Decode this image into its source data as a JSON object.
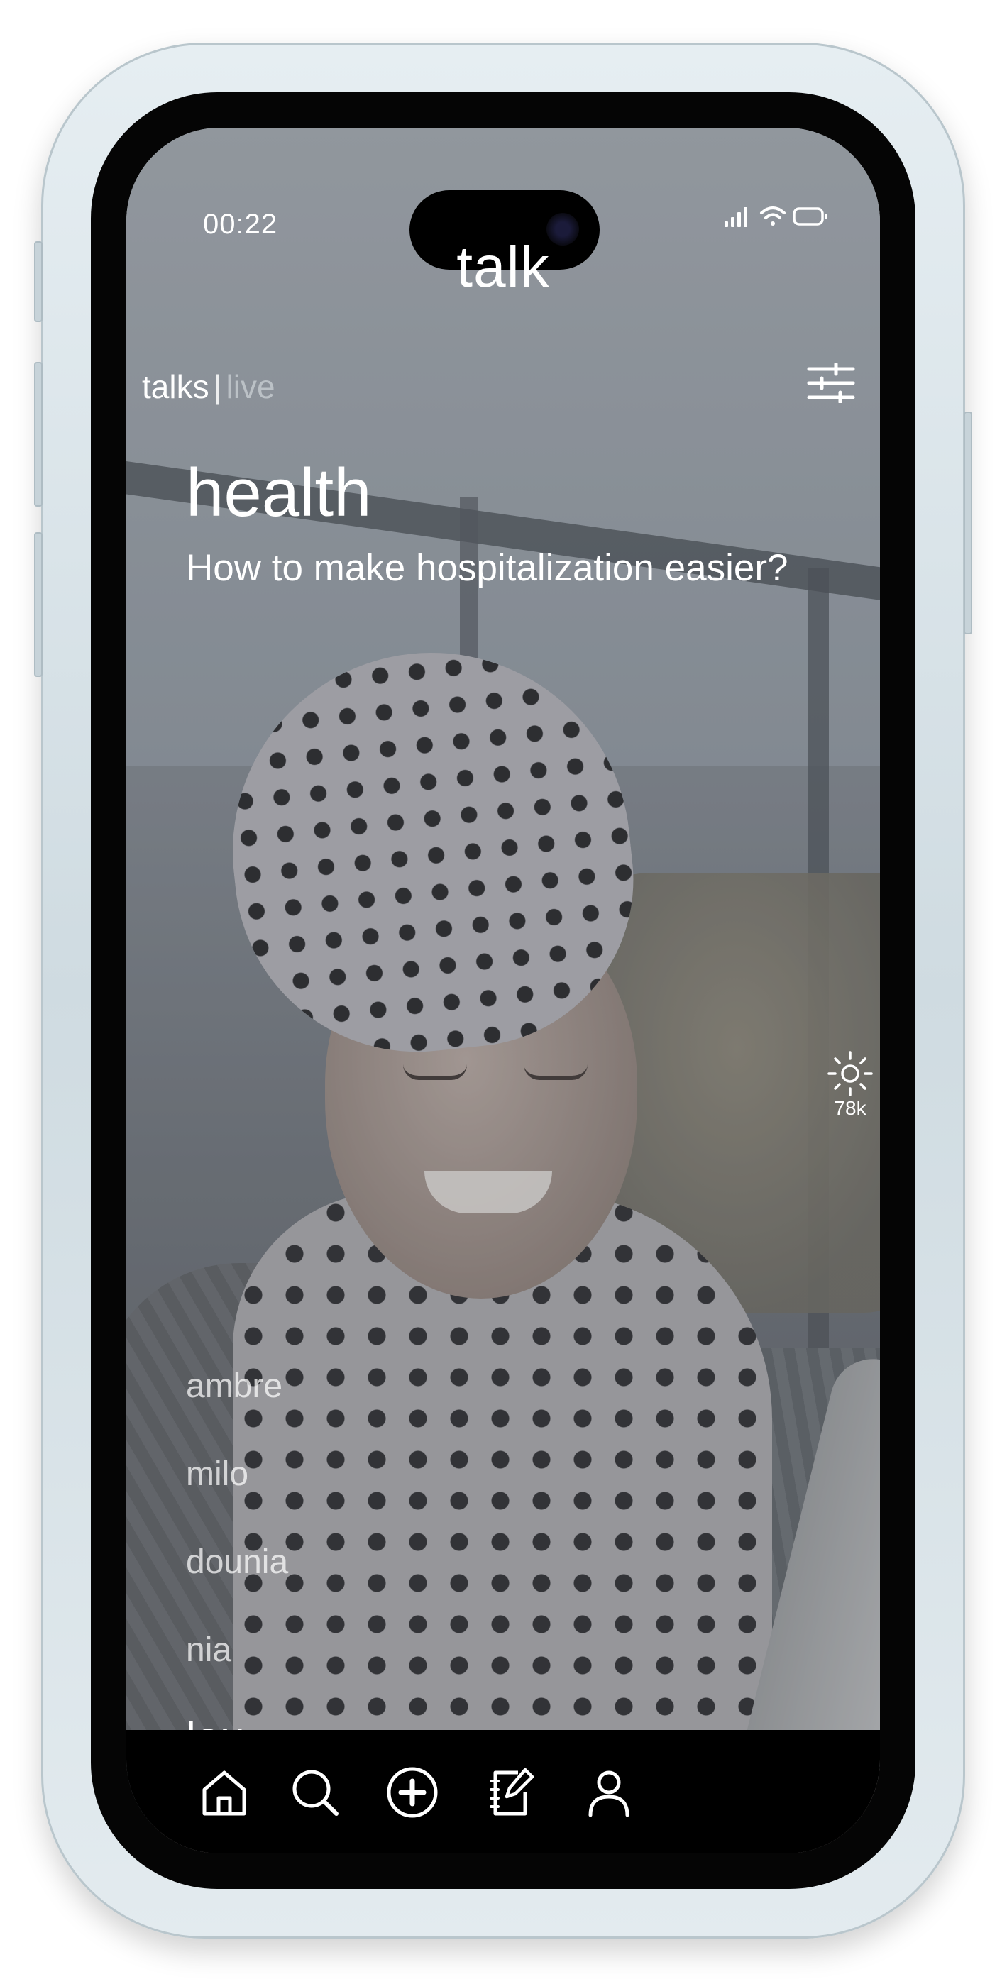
{
  "status_bar": {
    "time": "00:22"
  },
  "app": {
    "title": "talk"
  },
  "tabs": {
    "active": "talks",
    "separator": "|",
    "inactive": "live"
  },
  "topic": {
    "category": "health",
    "question": "How to make hospitalization easier?"
  },
  "likes": {
    "icon": "sun-icon",
    "count": "78k"
  },
  "participants": [
    {
      "name": "ambre"
    },
    {
      "name": "milo"
    },
    {
      "name": "dounia"
    },
    {
      "name": "nia"
    },
    {
      "name": "lou",
      "active": true
    }
  ],
  "bottom_nav": [
    {
      "icon": "home-icon"
    },
    {
      "icon": "search-icon"
    },
    {
      "icon": "add-icon"
    },
    {
      "icon": "notebook-icon"
    },
    {
      "icon": "profile-icon"
    }
  ],
  "colors": {
    "text": "#ffffff",
    "nav_background": "#000000",
    "inactive_tab": "#c8cdd2"
  }
}
